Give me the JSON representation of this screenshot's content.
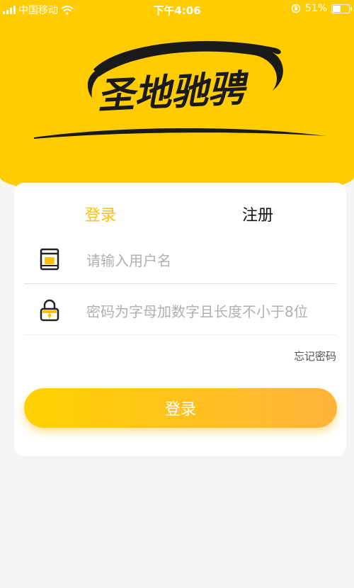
{
  "status_bar": {
    "carrier": "中国移动",
    "time": "下午4:06",
    "battery": "51%",
    "battery_level": 0.51
  },
  "logo": {
    "text": "圣地驰骋"
  },
  "tabs": {
    "login": "登录",
    "register": "注册"
  },
  "form": {
    "username_placeholder": "请输入用户名",
    "password_placeholder": "密码为字母加数字且长度不小于8位",
    "forgot_password": "忘记密码"
  },
  "login_button": "登录",
  "colors": {
    "brand_yellow": "#FFCC00",
    "active_tab": "#FFC107",
    "button_start": "#FFD200",
    "button_end": "#FFB33A"
  }
}
